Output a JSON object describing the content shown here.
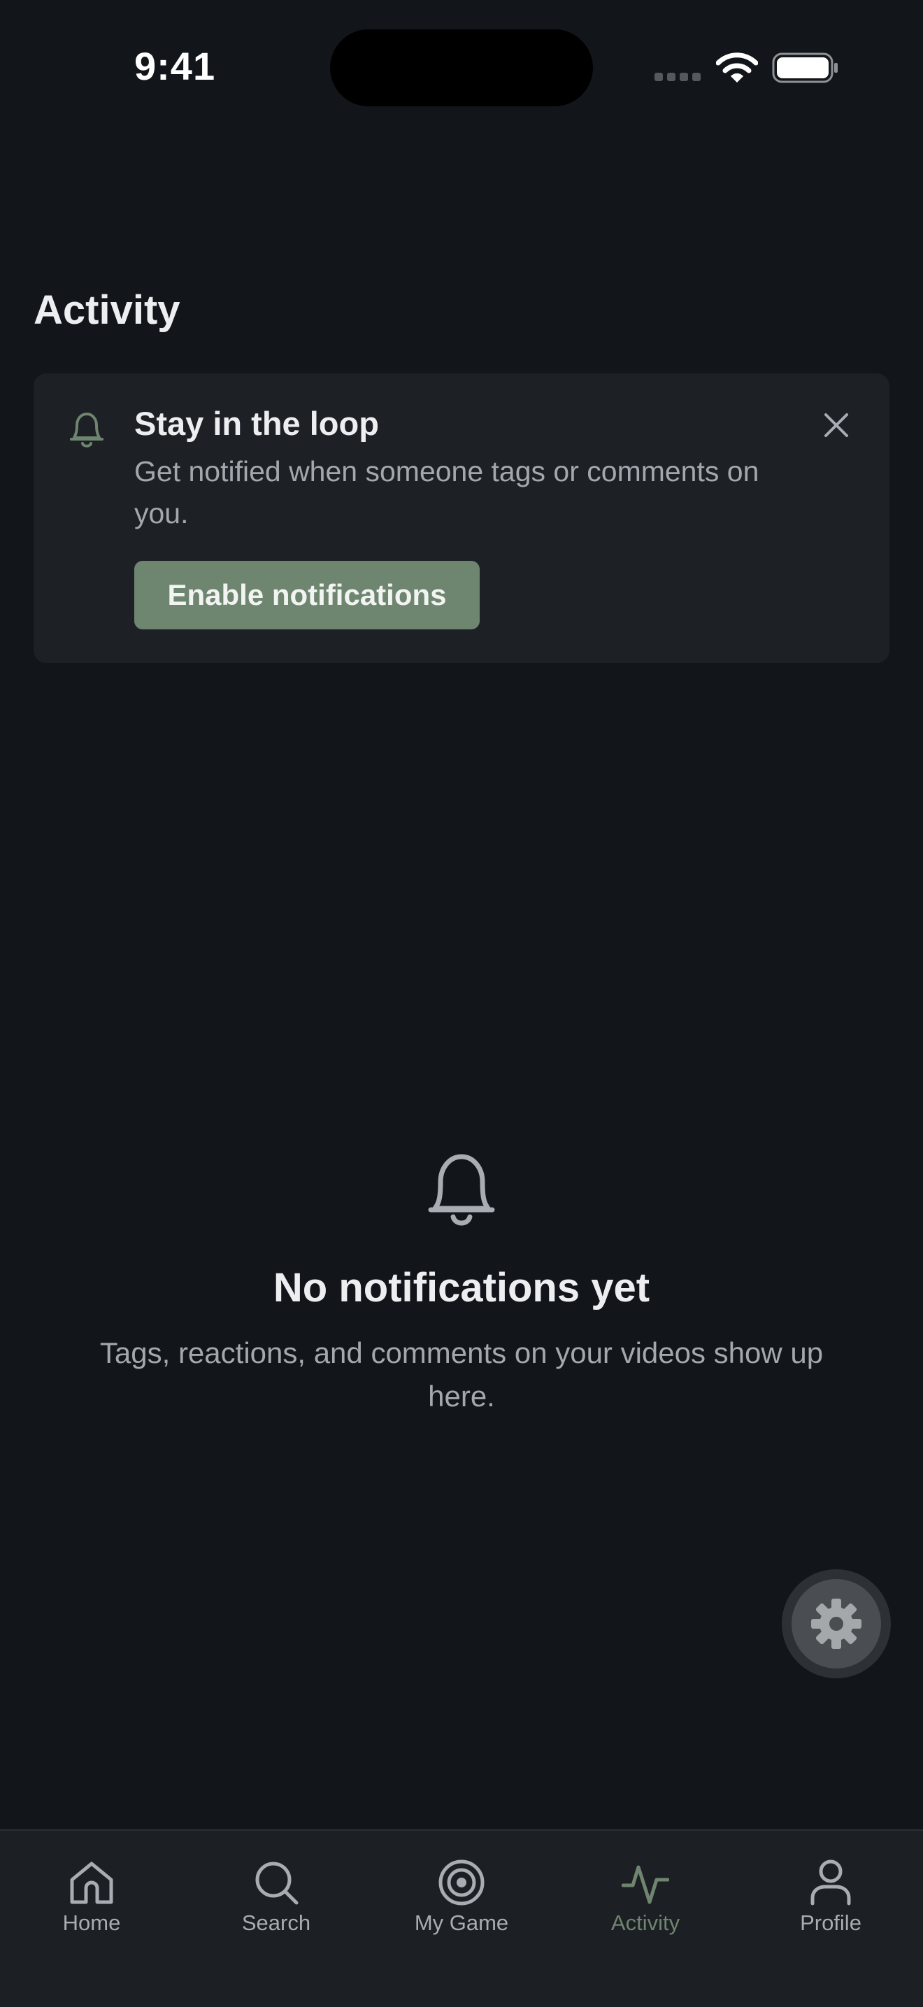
{
  "status_bar": {
    "time": "9:41"
  },
  "page": {
    "title": "Activity"
  },
  "prompt": {
    "title": "Stay in the loop",
    "text": "Get notified when someone tags or comments on you.",
    "button_label": "Enable notifications",
    "icon": "bell-icon",
    "dismiss_icon": "close-icon"
  },
  "empty_state": {
    "icon": "bell-icon",
    "title": "No notifications yet",
    "text": "Tags, reactions, and comments on your videos show up here."
  },
  "fab": {
    "icon": "gear-icon"
  },
  "tabs": [
    {
      "label": "Home",
      "icon": "home-icon",
      "active": false
    },
    {
      "label": "Search",
      "icon": "search-icon",
      "active": false
    },
    {
      "label": "My Game",
      "icon": "target-icon",
      "active": false
    },
    {
      "label": "Activity",
      "icon": "activity-icon",
      "active": true
    },
    {
      "label": "Profile",
      "icon": "profile-icon",
      "active": false
    }
  ],
  "colors": {
    "background": "#121519",
    "card": "#1d2125",
    "accent": "#6e8570",
    "text_primary": "#eceef0",
    "text_secondary": "#a2a8ae"
  }
}
